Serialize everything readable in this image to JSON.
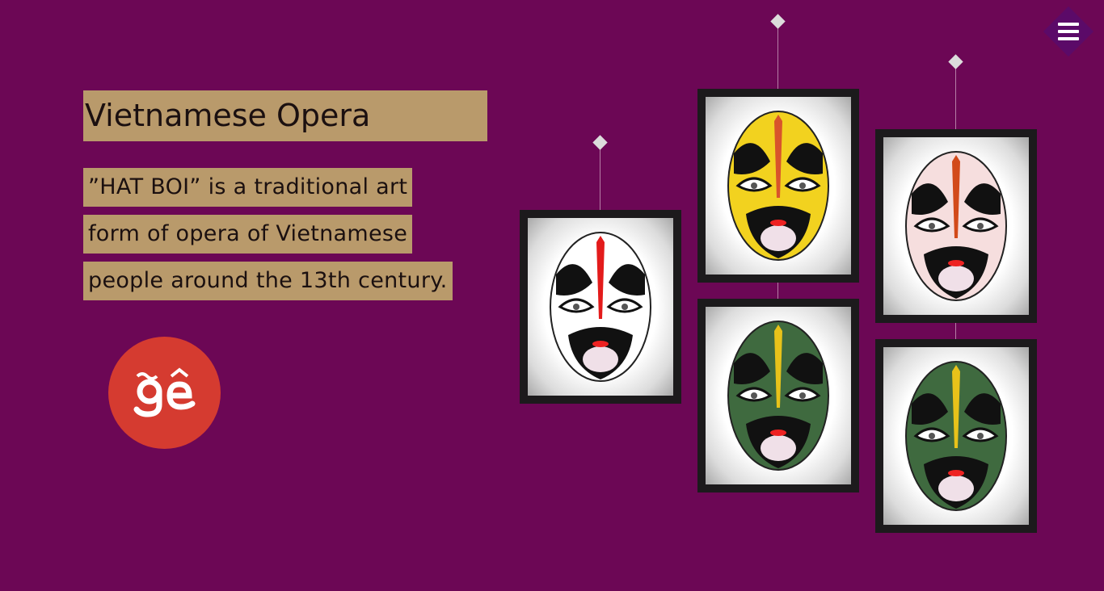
{
  "header": {
    "title": "Vietnamese Opera",
    "menu_icon": "hamburger-menu-icon"
  },
  "description": {
    "lines": [
      "”HAT BOI” is a traditional art",
      "form of opera of Vietnamese",
      "people around the 13th century."
    ]
  },
  "logo": {
    "text": "ĝê",
    "color": "#d53b30"
  },
  "gallery": {
    "masks": [
      {
        "name": "white-black-mask",
        "face_color": "#ffffff",
        "accent_color": "#e31b1b"
      },
      {
        "name": "yellow-mask",
        "face_color": "#f2d21f",
        "accent_color": "#d8542b"
      },
      {
        "name": "green-mask",
        "face_color": "#3f6a3f",
        "accent_color": "#e8c21a"
      },
      {
        "name": "pink-mask",
        "face_color": "#f6dede",
        "accent_color": "#d24a1a"
      },
      {
        "name": "green-mask",
        "face_color": "#3f6a3f",
        "accent_color": "#e8c21a"
      }
    ]
  },
  "colors": {
    "background": "#6c0755",
    "label_bg": "#b99a6b",
    "frame": "#1c1a1c"
  }
}
